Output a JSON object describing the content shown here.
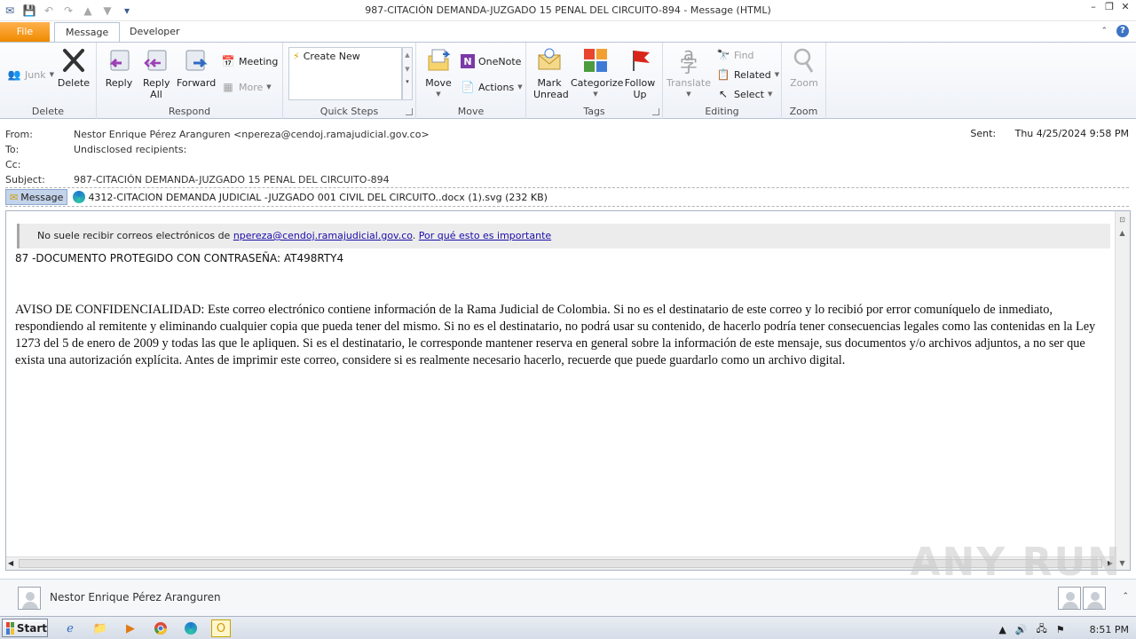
{
  "window": {
    "title": "987-CITACIÓN  DEMANDA-JUZGADO 15 PENAL DEL CIRCUITO-894  -  Message (HTML)"
  },
  "tabs": [
    {
      "label": "File"
    },
    {
      "label": "Message"
    },
    {
      "label": "Developer"
    }
  ],
  "ribbon": {
    "delete_group": {
      "label": "Delete",
      "junk": "Junk",
      "delete": "Delete"
    },
    "respond_group": {
      "label": "Respond",
      "reply": "Reply",
      "reply_all": "Reply All",
      "forward": "Forward",
      "meeting": "Meeting",
      "more": "More"
    },
    "quick_steps": {
      "label": "Quick Steps",
      "create_new": "Create New"
    },
    "move_group": {
      "label": "Move",
      "move": "Move",
      "onenote": "OneNote",
      "actions": "Actions"
    },
    "tags_group": {
      "label": "Tags",
      "mark_unread": "Mark Unread",
      "categorize": "Categorize",
      "follow_up": "Follow Up"
    },
    "editing_group": {
      "label": "Editing",
      "translate": "Translate",
      "find": "Find",
      "related": "Related",
      "select": "Select"
    },
    "zoom_group": {
      "label": "Zoom",
      "zoom": "Zoom"
    }
  },
  "header": {
    "from_label": "From:",
    "from_value": "Nestor Enrique Pérez Aranguren <npereza@cendoj.ramajudicial.gov.co>",
    "to_label": "To:",
    "to_value": "Undisclosed recipients:",
    "cc_label": "Cc:",
    "subject_label": "Subject:",
    "subject_value": "987-CITACIÓN  DEMANDA-JUZGADO 15 PENAL DEL CIRCUITO-894",
    "sent_label": "Sent:",
    "sent_value": "Thu 4/25/2024 9:58 PM"
  },
  "attachments": {
    "message_tab": "Message",
    "file": "4312-CITACION  DEMANDA JUDICIAL -JUZGADO 001 CIVIL DEL CIRCUITO..docx (1).svg (232 KB)"
  },
  "body": {
    "notice_prefix": "No suele recibir correos electrónicos de ",
    "notice_email": "npereza@cendoj.ramajudicial.gov.co",
    "notice_sep": ". ",
    "notice_link": "Por qué esto es importante",
    "doc_line": "87 -DOCUMENTO PROTEGIDO CON CONTRASEÑA:  AT498RTY4",
    "disclaimer": "AVISO DE CONFIDENCIALIDAD: Este correo electrónico contiene información de la Rama Judicial de Colombia. Si no es el destinatario de este correo y lo recibió por error comuníquelo de inmediato, respondiendo al remitente y eliminando cualquier copia que pueda tener del mismo. Si no es el destinatario, no podrá usar su contenido, de hacerlo podría tener consecuencias legales como las contenidas en la Ley 1273 del 5 de enero de 2009 y todas las que le apliquen. Si es el destinatario, le corresponde mantener reserva en general sobre la información de este mensaje, sus documentos y/o archivos adjuntos, a no ser que exista una autorización explícita. Antes de imprimir este correo, considere si es realmente necesario hacerlo, recuerde que puede guardarlo como un archivo digital."
  },
  "people_pane": {
    "name": "Nestor Enrique Pérez Aranguren"
  },
  "taskbar": {
    "start": "Start",
    "clock": "8:51 PM"
  },
  "watermark": "ANY RUN"
}
